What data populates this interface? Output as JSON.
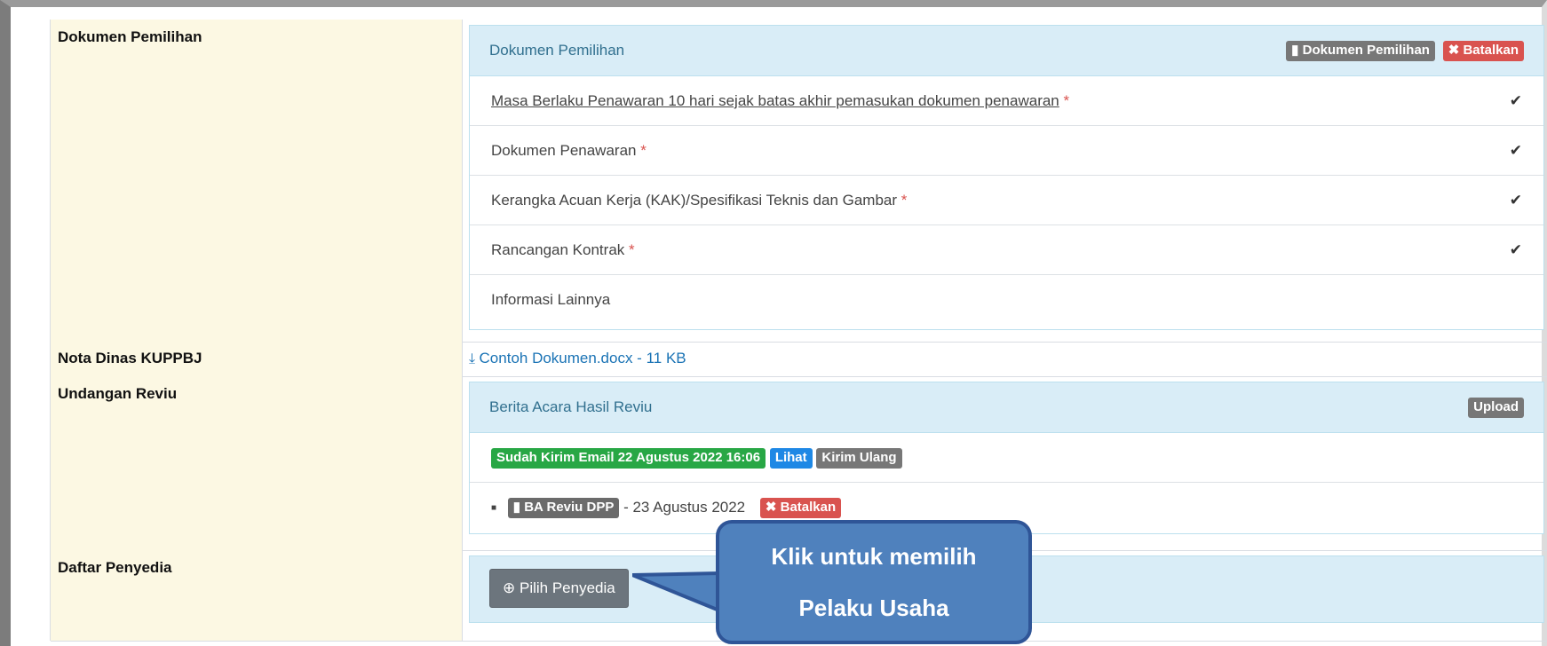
{
  "colors": {
    "accent_info_bg": "#d9edf7",
    "header_bg": "#fcf8e3",
    "danger": "#d9534f",
    "success": "#28a745",
    "primary": "#1e88e5",
    "callout": "#4f81bd"
  },
  "rows": {
    "dokumen": {
      "label": "Dokumen Pemilihan",
      "panel_title": "Dokumen Pemilihan",
      "btn_dokumen": "Dokumen Pemilihan",
      "btn_batalkan": "Batalkan",
      "items": [
        {
          "text": "Masa Berlaku Penawaran 10 hari sejak batas akhir pemasukan dokumen penawaran",
          "required": "*",
          "checked": "✔"
        },
        {
          "text": "Dokumen Penawaran",
          "required": "*",
          "checked": "✔"
        },
        {
          "text": "Kerangka Acuan Kerja (KAK)/Spesifikasi Teknis dan Gambar",
          "required": "*",
          "checked": "✔"
        },
        {
          "text": "Rancangan Kontrak",
          "required": "*",
          "checked": "✔"
        },
        {
          "text": "Informasi Lainnya"
        }
      ]
    },
    "nota": {
      "label": "Nota Dinas KUPPBJ",
      "file_link": "Contoh Dokumen.docx - 11 KB"
    },
    "undangan": {
      "label": "Undangan Reviu",
      "panel_title": "Berita Acara Hasil Reviu",
      "btn_upload": "Upload",
      "status": "Sudah Kirim Email 22 Agustus 2022 16:06",
      "btn_lihat": "Lihat",
      "btn_kirim_ulang": "Kirim Ulang",
      "doc_name": "BA Reviu DPP",
      "doc_date": "- 23 Agustus 2022",
      "btn_batalkan": "Batalkan"
    },
    "penyedia": {
      "label": "Daftar Penyedia",
      "btn_pilih": "Pilih Penyedia"
    }
  },
  "callout": {
    "line1": "Klik untuk memilih",
    "line2": "Pelaku Usaha"
  }
}
